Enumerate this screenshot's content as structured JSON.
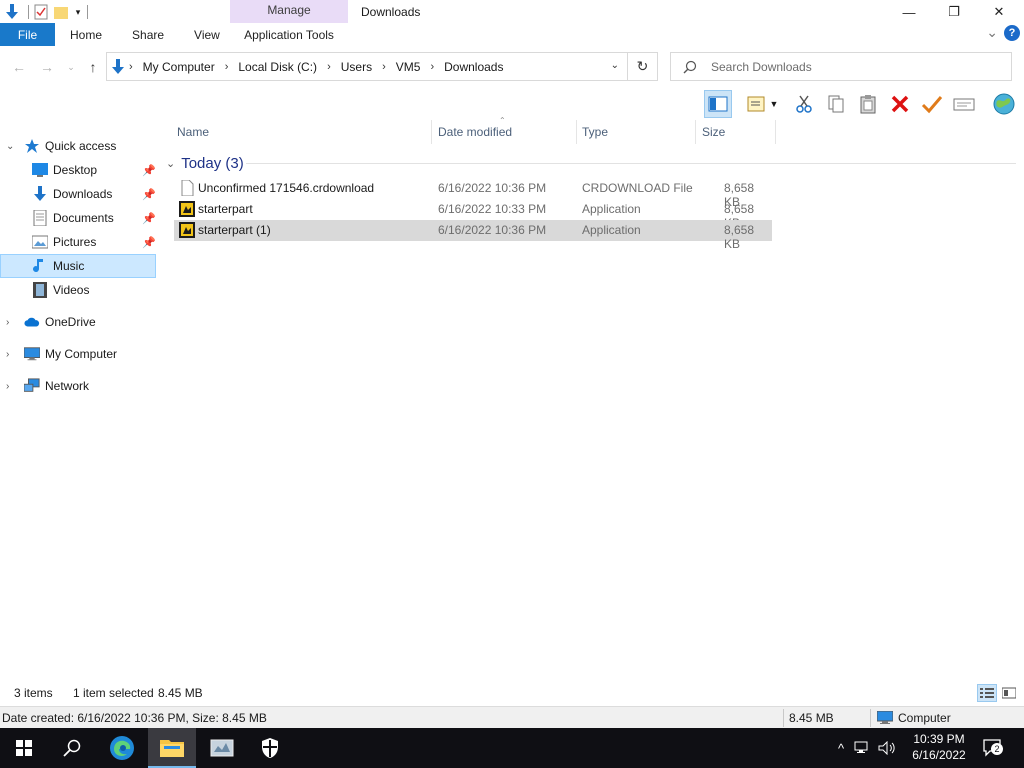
{
  "window": {
    "title": "Downloads",
    "context_tab_group": "Manage",
    "minimize_glyph": "—",
    "restore_glyph": "❐",
    "close_glyph": "✕"
  },
  "ribbon": {
    "tabs": [
      "File",
      "Home",
      "Share",
      "View",
      "Application Tools"
    ],
    "collapse_glyph": "⌄",
    "help_glyph": "?"
  },
  "address": {
    "breadcrumbs": [
      "My Computer",
      "Local Disk (C:)",
      "Users",
      "VM5",
      "Downloads"
    ],
    "separator": "›",
    "refresh_glyph": "↻"
  },
  "search": {
    "placeholder": "Search Downloads"
  },
  "nav": {
    "quick_access": "Quick access",
    "quick_items": [
      {
        "label": "Desktop",
        "icon": "desktop-icon",
        "pinned": true
      },
      {
        "label": "Downloads",
        "icon": "downloads-icon",
        "pinned": true
      },
      {
        "label": "Documents",
        "icon": "documents-icon",
        "pinned": true
      },
      {
        "label": "Pictures",
        "icon": "pictures-icon",
        "pinned": true
      },
      {
        "label": "Music",
        "icon": "music-icon",
        "pinned": false,
        "selected": true
      },
      {
        "label": "Videos",
        "icon": "videos-icon",
        "pinned": false
      }
    ],
    "roots": [
      {
        "label": "OneDrive",
        "icon": "onedrive-icon"
      },
      {
        "label": "My Computer",
        "icon": "computer-icon"
      },
      {
        "label": "Network",
        "icon": "network-icon"
      }
    ]
  },
  "filelist": {
    "columns": [
      "Name",
      "Date modified",
      "Type",
      "Size"
    ],
    "group_label": "Today (3)",
    "rows": [
      {
        "name": "Unconfirmed 171546.crdownload",
        "date": "6/16/2022 10:36 PM",
        "type": "CRDOWNLOAD File",
        "size": "8,658 KB",
        "icon": "blank-file-icon",
        "selected": false
      },
      {
        "name": "starterpart",
        "date": "6/16/2022 10:33 PM",
        "type": "Application",
        "size": "8,658 KB",
        "icon": "application-icon",
        "selected": false
      },
      {
        "name": "starterpart (1)",
        "date": "6/16/2022 10:36 PM",
        "type": "Application",
        "size": "8,658 KB",
        "icon": "application-icon",
        "selected": true
      }
    ]
  },
  "status": {
    "items_count": "3 items",
    "selection": "1 item selected",
    "selection_size": "8.45 MB"
  },
  "details_bar": {
    "info": "Date created: 6/16/2022 10:36 PM, Size: 8.45 MB",
    "size": "8.45 MB",
    "location": "Computer"
  },
  "taskbar": {
    "time": "10:39 PM",
    "date": "6/16/2022",
    "notification_count": "2",
    "tray_chevron": "^"
  },
  "colors": {
    "accent": "#1979ca",
    "manage_tab": "#e9dcf7",
    "selection": "#cce8ff",
    "group_header": "#1e3287",
    "taskbar": "#0f0f14"
  }
}
